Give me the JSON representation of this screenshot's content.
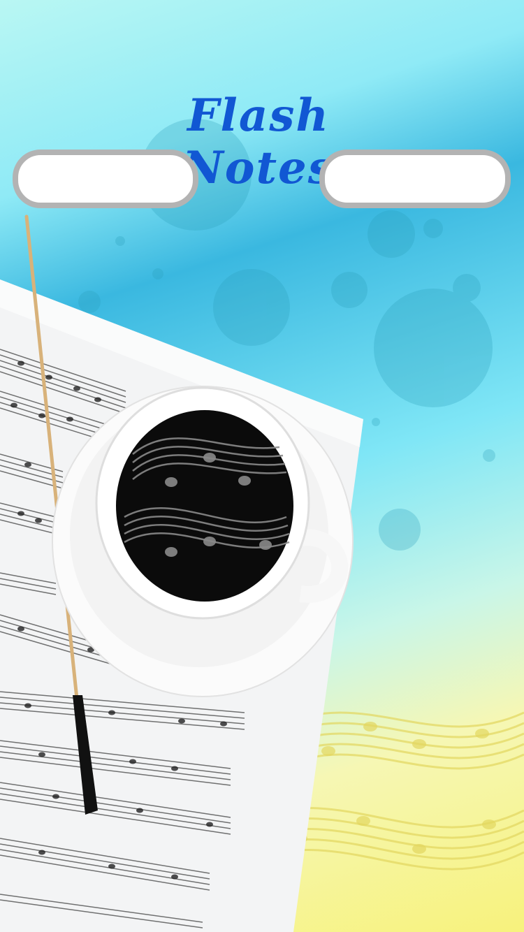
{
  "app": {
    "title": "Flash Notes"
  },
  "buttons": {
    "left_label": "",
    "right_label": ""
  },
  "colors": {
    "title": "#1157d3",
    "button_border": "#b3b3b3",
    "button_fill": "#ffffff"
  }
}
